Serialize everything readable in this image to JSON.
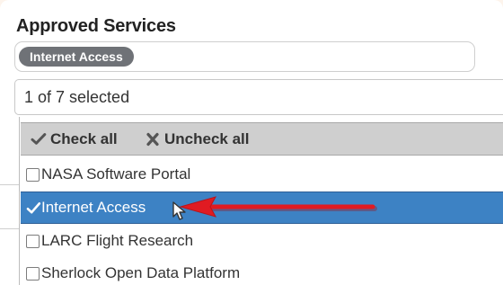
{
  "section": {
    "title": "Approved Services"
  },
  "selected_tags": [
    {
      "label": "Internet Access"
    }
  ],
  "select": {
    "summary": "1 of 7 selected"
  },
  "dropdown": {
    "check_all_label": "Check all",
    "uncheck_all_label": "Uncheck all",
    "options": [
      {
        "label": "NASA Software Portal",
        "checked": false
      },
      {
        "label": "Internet Access",
        "checked": true
      },
      {
        "label": "LARC Flight Research",
        "checked": false
      },
      {
        "label": "Sherlock Open Data Platform",
        "checked": false
      }
    ]
  },
  "icons": {
    "check_all": "check-icon",
    "uncheck_all": "x-icon",
    "selected_check": "check-icon",
    "cursor": "mouse-cursor-icon",
    "annotation": "red-arrow-icon"
  },
  "colors": {
    "tag_background": "#6f7277",
    "selected_row": "#3d82c4",
    "action_bar": "#cfcfcf",
    "annotation_arrow": "#e01b22"
  }
}
